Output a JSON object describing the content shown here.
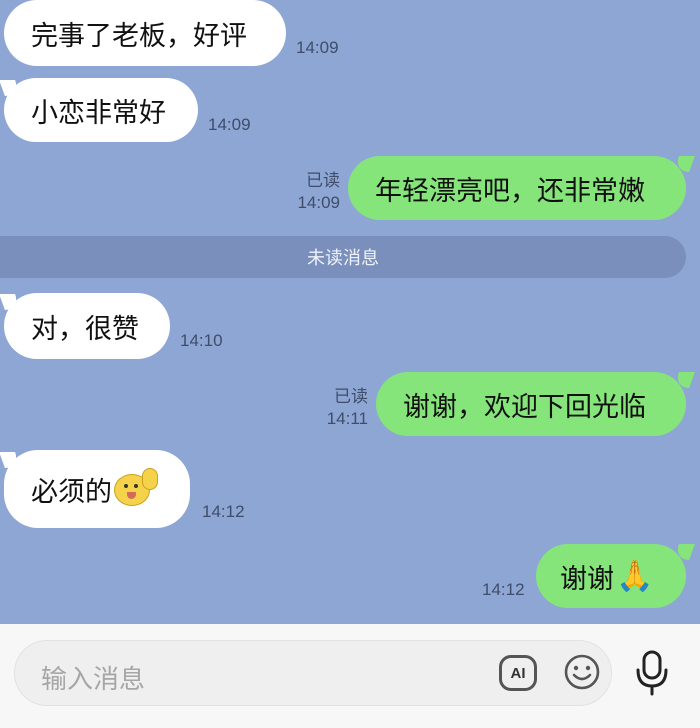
{
  "messages": [
    {
      "text": "完事了老板，好评",
      "time": "14:09",
      "dir": "in"
    },
    {
      "text": "小恋非常好",
      "time": "14:09",
      "dir": "in"
    },
    {
      "text": "年轻漂亮吧，还非常嫩",
      "time": "14:09",
      "dir": "out",
      "status": "已读"
    },
    {
      "text": "对，很赞",
      "time": "14:10",
      "dir": "in"
    },
    {
      "text": "谢谢，欢迎下回光临",
      "time": "14:11",
      "dir": "out",
      "status": "已读"
    },
    {
      "text": "必须的",
      "time": "14:12",
      "dir": "in",
      "emoji": "thumbs-up-face-sticker"
    },
    {
      "text": "谢谢",
      "time": "14:12",
      "dir": "out",
      "emoji": "folded-hands-emoji"
    }
  ],
  "divider_text": "未读消息",
  "input": {
    "placeholder": "输入消息"
  },
  "icons": {
    "ai": "AI",
    "emoji": "smile-icon",
    "voice": "microphone-icon"
  },
  "colors": {
    "background": "#8ea6d4",
    "outgoing": "#86e57a",
    "incoming": "#ffffff"
  }
}
